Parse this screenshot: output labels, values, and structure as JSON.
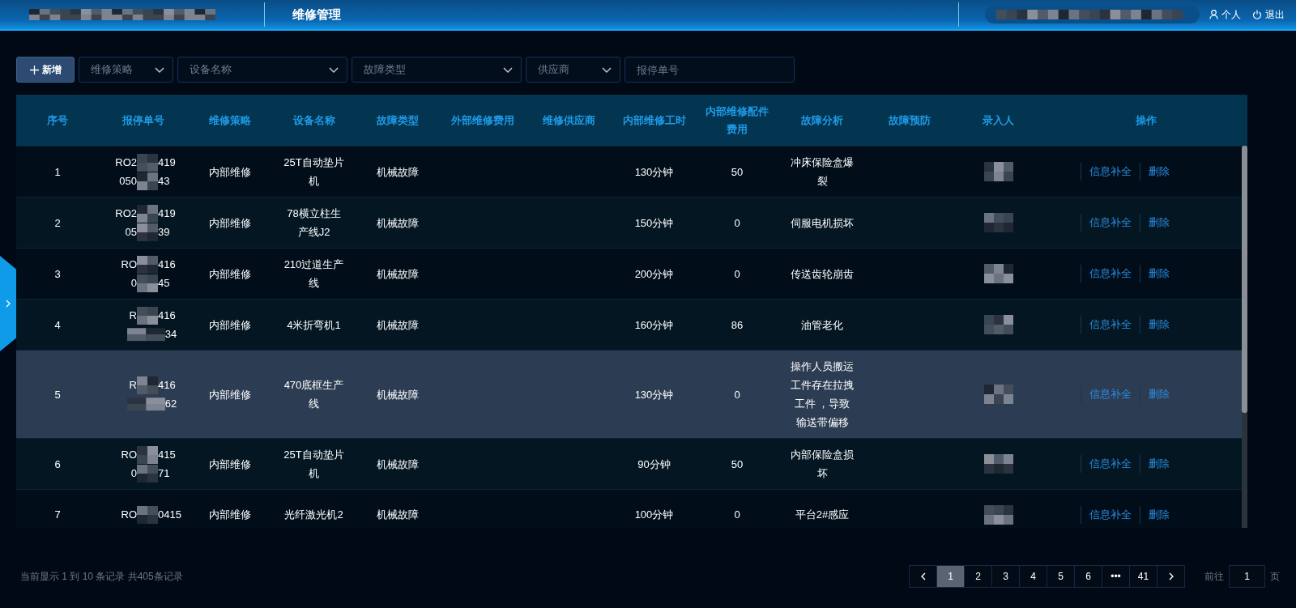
{
  "header": {
    "title": "维修管理",
    "links": [
      {
        "kind": "user",
        "label": "个人"
      },
      {
        "kind": "power",
        "label": "退出"
      }
    ]
  },
  "toolbar": {
    "add_button": "新增",
    "filters": [
      {
        "kind": "select",
        "placeholder": "维修策略"
      },
      {
        "kind": "select",
        "placeholder": "设备名称"
      },
      {
        "kind": "select",
        "placeholder": "故障类型"
      },
      {
        "kind": "select",
        "placeholder": "供应商"
      },
      {
        "kind": "input",
        "placeholder": "报停单号"
      }
    ]
  },
  "table": {
    "columns": [
      "序号",
      "报停单号",
      "维修策略",
      "设备名称",
      "故障类型",
      "外部维修费用",
      "维修供应商",
      "内部维修工时",
      "内部维修配件费用",
      "故障分析",
      "故障预防",
      "录入人",
      "操作"
    ],
    "rows": [
      {
        "no": "1",
        "report_no": [
          {
            "start": "RO2",
            "end": "419"
          },
          {
            "start": "050",
            "end": "43"
          }
        ],
        "strategy": "内部维修",
        "device": "25T自动垫片机",
        "fault_type": "机械故障",
        "labor": "130分钟",
        "parts_cost": "50",
        "analysis": "冲床保险盒爆裂",
        "actions": [
          "信息补全",
          "删除"
        ],
        "selected": false
      },
      {
        "no": "2",
        "report_no": [
          {
            "start": "RO2",
            "end": "419"
          },
          {
            "start": "05",
            "end": "39"
          }
        ],
        "strategy": "内部维修",
        "device": "78横立柱生产线J2",
        "fault_type": "机械故障",
        "labor": "150分钟",
        "parts_cost": "0",
        "analysis": "伺服电机损坏",
        "actions": [
          "信息补全",
          "删除"
        ],
        "selected": false
      },
      {
        "no": "3",
        "report_no": [
          {
            "start": "RO",
            "end": "416"
          },
          {
            "start": "0",
            "end": "45"
          }
        ],
        "strategy": "内部维修",
        "device": "210过道生产线",
        "fault_type": "机械故障",
        "labor": "200分钟",
        "parts_cost": "0",
        "analysis": "传送齿轮崩齿",
        "actions": [
          "信息补全",
          "删除"
        ],
        "selected": false
      },
      {
        "no": "4",
        "report_no": [
          {
            "start": "R",
            "end": "416"
          },
          {
            "end": "34"
          }
        ],
        "strategy": "内部维修",
        "device": "4米折弯机1",
        "fault_type": "机械故障",
        "labor": "160分钟",
        "parts_cost": "86",
        "analysis": "油管老化",
        "actions": [
          "信息补全",
          "删除"
        ],
        "selected": false
      },
      {
        "no": "5",
        "report_no": [
          {
            "start": "R",
            "end": "416"
          },
          {
            "end": "62"
          }
        ],
        "strategy": "内部维修",
        "device": "470底框生产线",
        "fault_type": "机械故障",
        "labor": "130分钟",
        "parts_cost": "0",
        "analysis": "操作人员搬运工件存在拉拽工件 ，导致输送带偏移",
        "actions": [
          "信息补全",
          "删除"
        ],
        "selected": true
      },
      {
        "no": "6",
        "report_no": [
          {
            "start": "RO",
            "end": "415"
          },
          {
            "start": "0",
            "end": "71"
          }
        ],
        "strategy": "内部维修",
        "device": "25T自动垫片机",
        "fault_type": "机械故障",
        "labor": "90分钟",
        "parts_cost": "50",
        "analysis": "内部保险盒损坏",
        "actions": [
          "信息补全",
          "删除"
        ],
        "selected": false
      },
      {
        "no": "7",
        "report_no": [
          {
            "start": "RO",
            "end": "0415"
          }
        ],
        "strategy": "内部维修",
        "device": "光纤激光机2",
        "fault_type": "机械故障",
        "labor": "100分钟",
        "parts_cost": "0",
        "analysis": "平台2#感应",
        "actions": [
          "信息补全",
          "删除"
        ],
        "selected": false
      }
    ]
  },
  "footer": {
    "summary": "当前显示 1 到 10 条记录 共405条记录",
    "pages": [
      {
        "label": "1",
        "selected": true
      },
      {
        "label": "2",
        "selected": false
      },
      {
        "label": "3",
        "selected": false
      },
      {
        "label": "4",
        "selected": false
      },
      {
        "label": "5",
        "selected": false
      },
      {
        "label": "6",
        "selected": false
      },
      {
        "label": "•••",
        "selected": false
      },
      {
        "label": "41",
        "selected": false
      }
    ],
    "goto_label": "前往",
    "goto_value": "1",
    "page_unit": "页"
  }
}
